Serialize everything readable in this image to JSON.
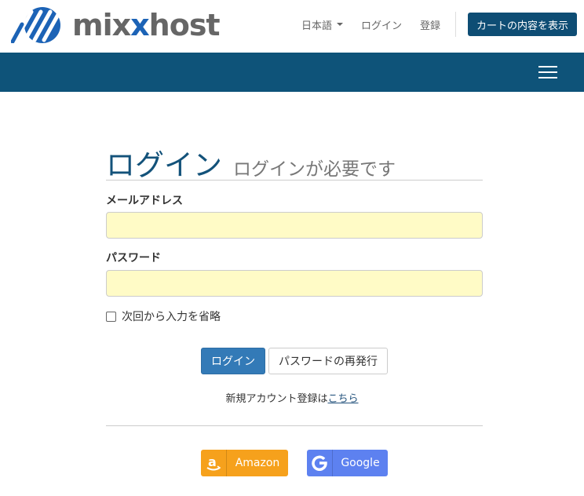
{
  "header": {
    "logo_text_a": "mix",
    "logo_text_x": "x",
    "logo_text_b": "host",
    "language": "日本語",
    "login_link": "ログイン",
    "register_link": "登録",
    "cart_button": "カートの内容を表示"
  },
  "login": {
    "title": "ログイン",
    "subtitle": "ログインが必要です",
    "email_label": "メールアドレス",
    "email_value": "",
    "password_label": "パスワード",
    "password_value": "",
    "remember_label": "次回から入力を省略",
    "submit_button": "ログイン",
    "reset_button": "パスワードの再発行",
    "signup_text": "新規アカウント登録は",
    "signup_link": "こちら"
  },
  "social": {
    "amazon_label": "Amazon",
    "amazon_icon": "amazon-icon",
    "google_label": "Google",
    "google_icon": "google-icon"
  },
  "colors": {
    "brand_dark": "#0e5379",
    "primary_button": "#337ab7",
    "input_fill": "#fffbc6",
    "amazon": "#f6a11c",
    "google": "#5d81f0"
  }
}
